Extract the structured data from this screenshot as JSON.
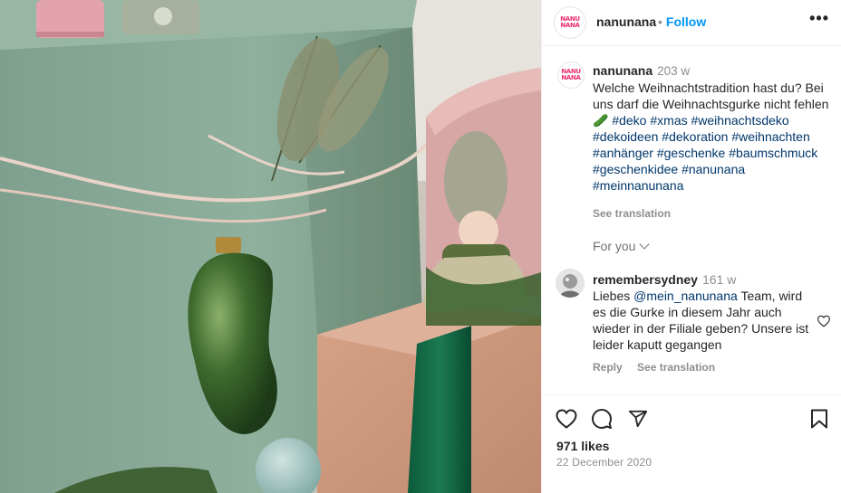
{
  "post": {
    "username": "nanunana",
    "separator": "•",
    "follow_label": "Follow",
    "more_label": "•••",
    "logo_text_top": "NANU",
    "logo_text_bottom": "NANA"
  },
  "caption": {
    "username": "nanunana",
    "time": "203 w",
    "text": "Welche Weihnachtstradition hast du? Bei uns darf die Weihnachtsgurke nicht fehlen 🥒",
    "hashtags": [
      "#deko",
      "#xmas",
      "#weihnachtsdeko",
      "#dekoideen",
      "#dekoration",
      "#weihnachten",
      "#anhänger",
      "#geschenke",
      "#baumschmuck",
      "#geschenkidee",
      "#nanunana",
      "#meinnanunana"
    ],
    "see_translation": "See translation"
  },
  "for_you": {
    "label": "For you"
  },
  "comment": {
    "username": "remembersydney",
    "time": "161 w",
    "prefix": "Liebes",
    "mention": "@mein_nanunana",
    "text": "Team, wird es die Gurke in diesem Jahr auch wieder in der Filiale geben? Unsere ist leider kaputt gegangen",
    "reply_label": "Reply",
    "see_translation": "See translation"
  },
  "actions": {
    "like_icon": "heart-icon",
    "comment_icon": "comment-icon",
    "share_icon": "paper-plane-icon",
    "save_icon": "bookmark-icon"
  },
  "stats": {
    "likes": "971 likes",
    "date": "22 December 2020"
  },
  "colors": {
    "brand": "#ee2d6c",
    "link": "#00376b",
    "follow": "#0095f6",
    "muted": "#8e8e8e"
  }
}
